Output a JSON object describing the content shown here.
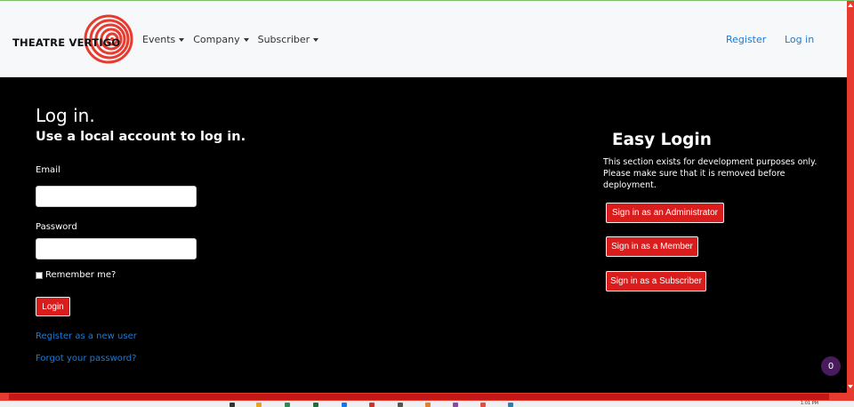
{
  "brand": {
    "name": "THEATRE VERTIGO"
  },
  "nav": {
    "menus": [
      {
        "label": "Events"
      },
      {
        "label": "Company"
      },
      {
        "label": "Subscriber"
      }
    ],
    "register": "Register",
    "login": "Log in"
  },
  "login": {
    "title": "Log in.",
    "subtitle": "Use a local account to log in.",
    "email_label": "Email",
    "email_value": "",
    "password_label": "Password",
    "password_value": "",
    "remember_label": "Remember me?",
    "submit_label": "Login",
    "register_link": "Register as a new user",
    "forgot_link": "Forgot your password?"
  },
  "easy_login": {
    "title": "Easy Login",
    "description": "This section exists for development purposes only. Please make sure that it is removed before deployment.",
    "buttons": [
      {
        "label": "Sign in as an Administrator"
      },
      {
        "label": "Sign in as a Member"
      },
      {
        "label": "Sign in as a Subscriber"
      }
    ]
  },
  "notification_badge": {
    "count": "0"
  },
  "colors": {
    "accent": "#d91d1d",
    "link": "#1a7bd6",
    "nav_bg": "#f7f8fa",
    "main_bg": "#000000"
  },
  "icons": [
    "spiral-logo-icon",
    "caret-down-icon",
    "checkbox-icon"
  ],
  "taskbar": {
    "time": "1:01 PM"
  }
}
